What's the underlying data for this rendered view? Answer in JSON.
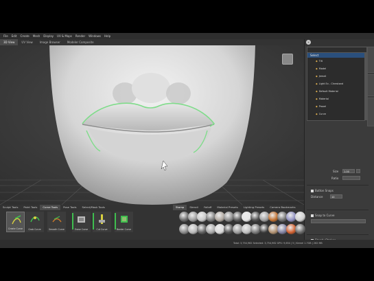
{
  "menu": [
    "File",
    "Edit",
    "Create",
    "Mesh",
    "Display",
    "UV & Maps",
    "Render",
    "Windows",
    "Help"
  ],
  "view_tabs": [
    "3D View",
    "UV View",
    "Image Browser",
    "Modeler Composite"
  ],
  "tree": {
    "header": "Select",
    "items": [
      "Tilt",
      "Model",
      "Jemail",
      "Light Ex - Chrestand",
      "Default Material",
      "Material",
      "Proxel",
      "Curve"
    ]
  },
  "properties": {
    "size_label": "Size",
    "size_value": "1.00",
    "ratio_label": "Ratio",
    "ratio_value": "",
    "snap_label": "Button Snaps",
    "distance_label": "Distance",
    "distance_value": "10",
    "snap_curve_label": "Snap to Curve",
    "steady_label": "Steady Strokes"
  },
  "bottom_tabs": [
    "Sculpt Tools",
    "Paint Tools",
    "Curve Tools",
    "Pose Tools",
    "Select/Mask Tools"
  ],
  "tools": [
    "Create Curve",
    "Grab Curve",
    "Smooth Curve",
    "Erase Curve",
    "Cut Curve",
    "Border Curve"
  ],
  "stamp_tabs": [
    "Stamp",
    "Stencil",
    "Falloff",
    "Material Presets",
    "Lighting Presets",
    "Camera Bookmarks"
  ],
  "status": "Total: 3,754,962 Selected: 3,754,962 GPU: 9,654 | 5 | Kernel 1.7GB | 262 MB",
  "colors": {
    "accent_green": "#3fbf4f",
    "select_highlight": "#2a4f7c",
    "curve_green": "#7fdc8a"
  }
}
